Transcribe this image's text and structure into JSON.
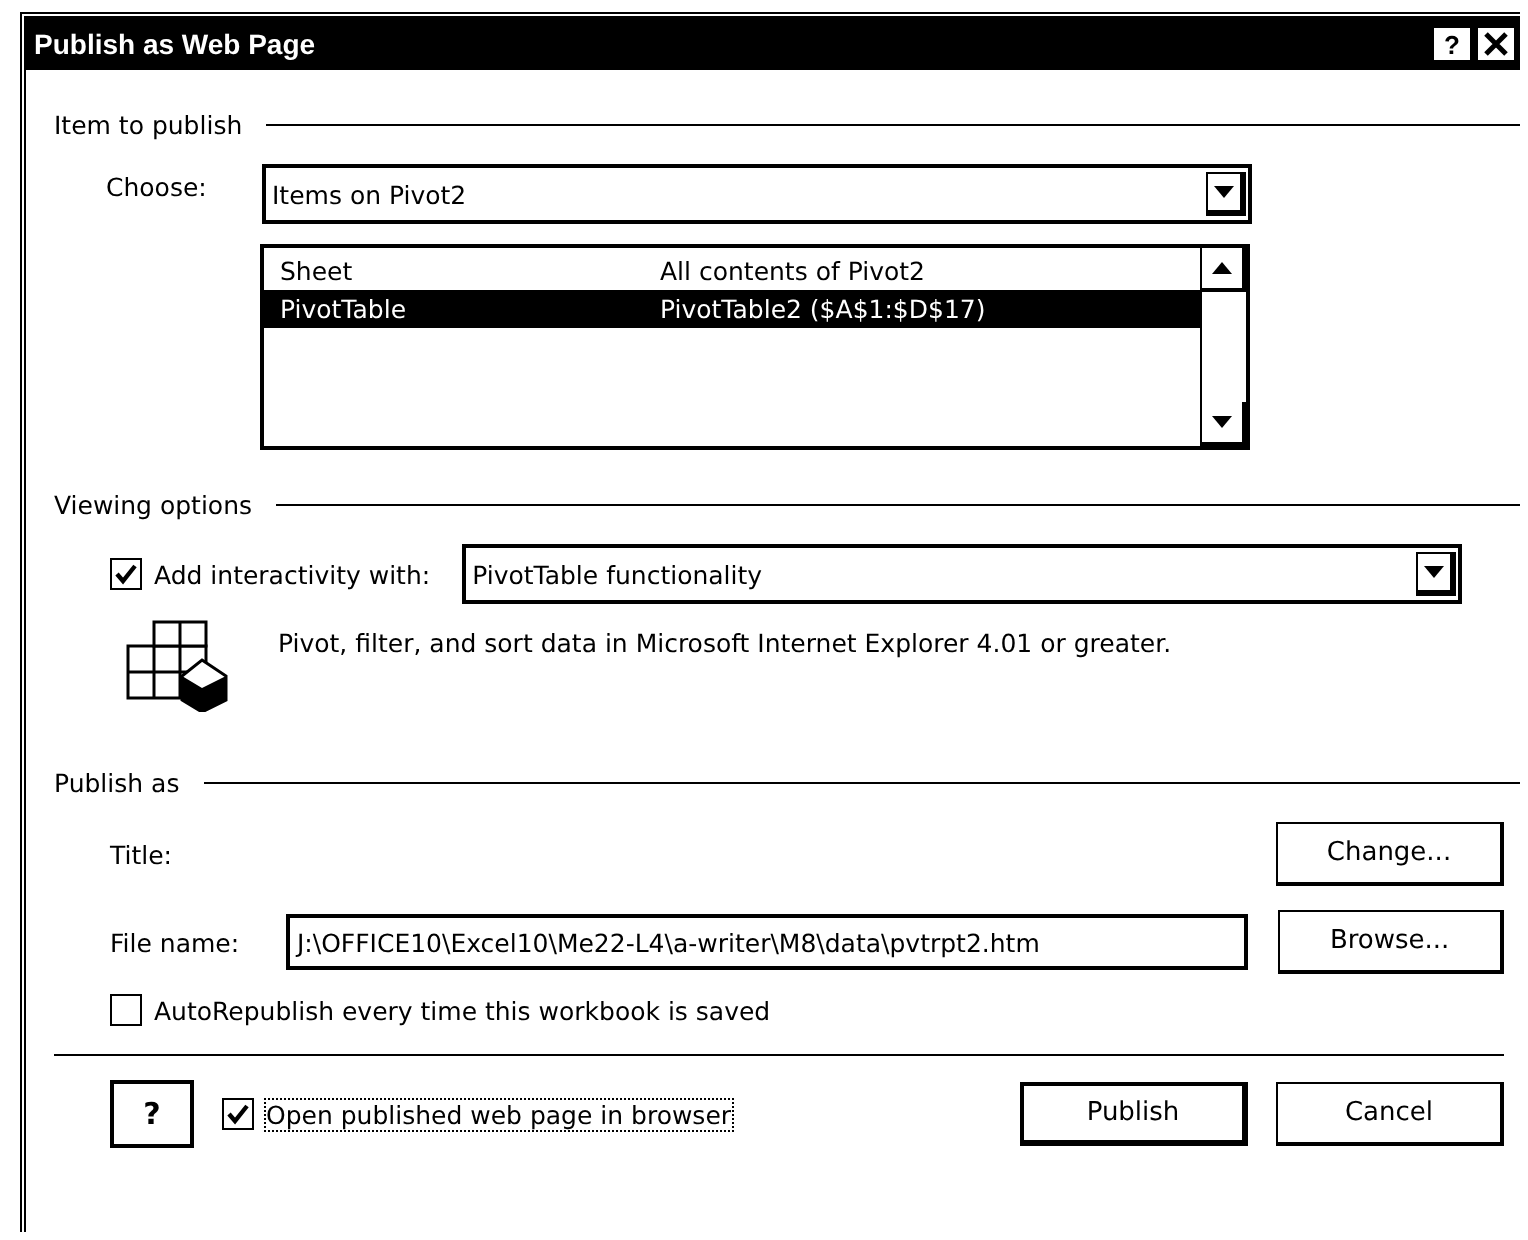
{
  "window": {
    "title": "Publish as Web Page",
    "help_glyph": "?"
  },
  "item_to_publish": {
    "heading": "Item to publish",
    "choose_label": "Choose:",
    "choose_value": "Items on Pivot2",
    "items": [
      {
        "type": "Sheet",
        "description": "All contents of Pivot2",
        "selected": false
      },
      {
        "type": "PivotTable",
        "description": "PivotTable2 ($A$1:$D$17)",
        "selected": true
      }
    ]
  },
  "viewing_options": {
    "heading": "Viewing options",
    "interactivity": {
      "label": "Add interactivity with:",
      "checked": true
    },
    "interactivity_value": "PivotTable functionality",
    "description": "Pivot, filter, and sort data in Microsoft Internet Explorer 4.01 or greater."
  },
  "publish_as": {
    "heading": "Publish as",
    "title_label": "Title:",
    "change_button": "Change...",
    "file_name_label": "File name:",
    "file_name": "J:\\OFFICE10\\Excel10\\Me22-L4\\a-writer\\M8\\data\\pvtrpt2.htm",
    "browse_button": "Browse...",
    "autorepublish": {
      "label": "AutoRepublish every time this workbook is saved",
      "checked": false
    }
  },
  "footer": {
    "help_glyph": "?",
    "open_in_browser": {
      "label": "Open published web page in browser",
      "checked": true
    },
    "buttons": [
      "Publish",
      "Cancel"
    ]
  }
}
